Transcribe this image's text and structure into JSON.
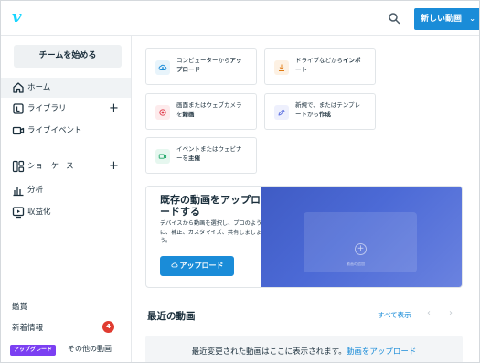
{
  "header": {
    "logo": "v",
    "new_video_label": "新しい動画",
    "new_video_chevron": "⌄",
    "search_icon": "search-icon"
  },
  "sidebar": {
    "start_team": "チームを始める",
    "items": [
      {
        "label": "ホーム",
        "icon": "home-icon",
        "active": true
      },
      {
        "label": "ライブラリ",
        "icon": "library-icon",
        "plus": "+"
      },
      {
        "label": "ライブイベント",
        "icon": "live-event-icon"
      },
      {
        "label": "ショーケース",
        "icon": "showcase-icon",
        "plus": "+"
      },
      {
        "label": "分析",
        "icon": "analytics-icon"
      },
      {
        "label": "収益化",
        "icon": "monetize-icon"
      }
    ],
    "watch": "鑑賞",
    "new_info": "新着情報",
    "new_info_count": "4",
    "upgrade_tag": "アップグレード",
    "other_videos": "その他の動画"
  },
  "actions": [
    {
      "line1": "コンピューターから",
      "bold1": "アッ",
      "line2": "",
      "bold2": "プロード",
      "icon": "cloud-upload-icon",
      "color": "#e8f4fb",
      "fg": "#1a8cd8"
    },
    {
      "line1": "ドライブなどから",
      "bold1": "インポ",
      "line2": "",
      "bold2": "ート",
      "icon": "import-icon",
      "color": "#fdf1e3",
      "fg": "#e07a12"
    },
    {
      "line1": "画面またはウェブカメラ",
      "bold1": "",
      "line2": "を",
      "bold2": "録画",
      "icon": "record-icon",
      "color": "#fdebec",
      "fg": "#e0394a"
    },
    {
      "line1": "新規で、またはテンプレ",
      "bold1": "",
      "line2": "ートから",
      "bold2": "作成",
      "icon": "create-icon",
      "color": "#eef0fd",
      "fg": "#5a6ee0"
    },
    {
      "line1": "イベントまたはウェビナ",
      "bold1": "",
      "line2": "ーを",
      "bold2": "主催",
      "icon": "event-icon",
      "color": "#e6f7ef",
      "fg": "#1fa768"
    }
  ],
  "hero": {
    "title": "既存の動画をアップロードする",
    "description": "デバイスから動画を選択し、プロのように、補正、カスタマイズ、共有しましょう。",
    "upload_button": "アップロード",
    "image_caption": "動画の追加"
  },
  "recent": {
    "title": "最近の動画",
    "see_all": "すべて表示",
    "empty_text": "最近変更された動画はここに表示されます。",
    "empty_link": "動画をアップロード"
  }
}
